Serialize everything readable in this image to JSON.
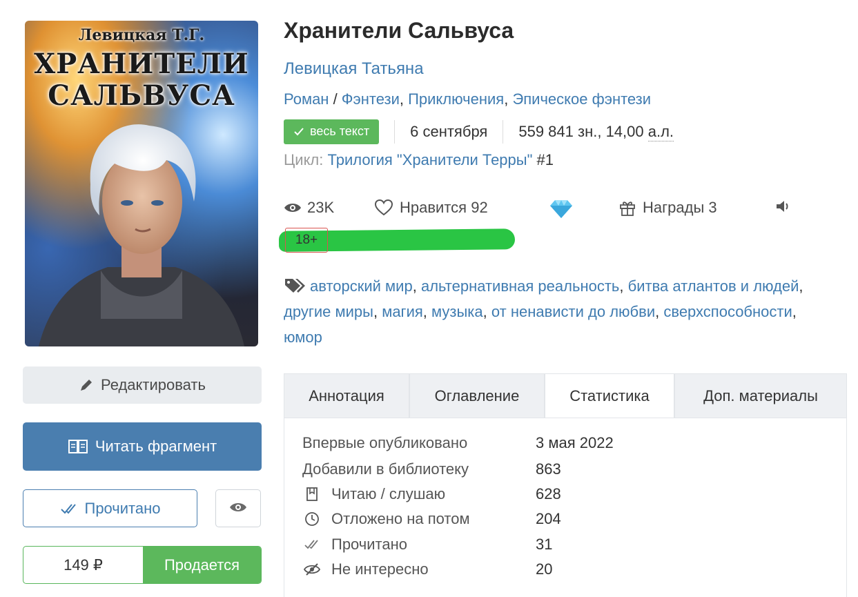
{
  "cover": {
    "author_text": "Левицкая Т.Г.",
    "title_line1": "ХРАНИТЕЛИ",
    "title_line2": "САЛЬВУСА"
  },
  "actions": {
    "edit_label": "Редактировать",
    "read_fragment_label": "Читать фрагмент",
    "read_done_label": "Прочитано",
    "price": "149 ₽",
    "sale_label": "Продается"
  },
  "book": {
    "title": "Хранители Сальвуса",
    "author": "Левицкая Татьяна",
    "genre_prefix": "Роман",
    "genre_sep": " / ",
    "genres": [
      "Фэнтези",
      "Приключения",
      "Эпическое фэнтези"
    ],
    "status_badge": "весь текст",
    "date": "6 сентября",
    "size_chars": "559 841 зн., 14,00",
    "size_unit": "а.л.",
    "cycle_label": "Цикл:",
    "cycle_name": "Трилогия \"Хранители Терры\"",
    "cycle_num": "#1"
  },
  "stats_bar": {
    "views": "23K",
    "likes_label": "Нравится",
    "likes_count": "92",
    "awards_label": "Награды",
    "awards_count": "3",
    "age_rating": "18+"
  },
  "tags": [
    "авторский мир",
    "альтернативная реальность",
    "битва атлантов и людей",
    "другие миры",
    "магия",
    "музыка",
    "от ненависти до любви",
    "сверхспособности",
    "юмор"
  ],
  "tabs": [
    {
      "label": "Аннотация"
    },
    {
      "label": "Оглавление"
    },
    {
      "label": "Статистика"
    },
    {
      "label": "Доп. материалы"
    }
  ],
  "active_tab": "Статистика",
  "statistics": [
    {
      "label": "Впервые опубликовано",
      "value": "3 мая 2022",
      "icon": ""
    },
    {
      "label": "Добавили в библиотеку",
      "value": "863",
      "icon": ""
    },
    {
      "label": "Читаю / слушаю",
      "value": "628",
      "icon": "bookmark-icon"
    },
    {
      "label": "Отложено на потом",
      "value": "204",
      "icon": "clock-icon"
    },
    {
      "label": "Прочитано",
      "value": "31",
      "icon": "double-check-icon"
    },
    {
      "label": "Не интересно",
      "value": "20",
      "icon": "eye-slash-icon"
    }
  ],
  "colors": {
    "link": "#3f7bb0",
    "primary_button": "#4a7eaf",
    "success": "#5cb85c",
    "age_border": "#d9534f",
    "highlight": "#1fc23a"
  }
}
